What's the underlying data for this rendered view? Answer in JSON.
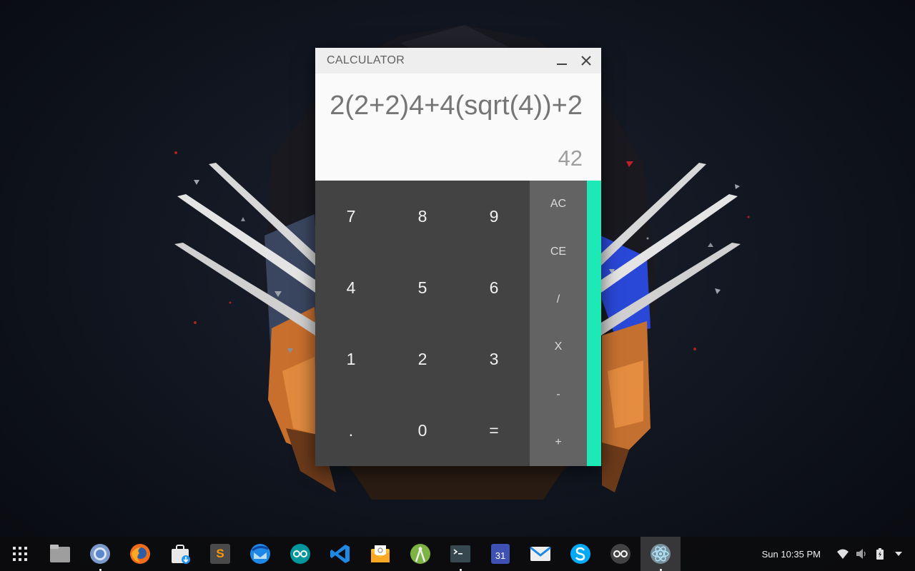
{
  "window": {
    "title": "CALCULATOR",
    "expression": "2(2+2)4+4(sqrt(4))+2",
    "result": "42"
  },
  "keypad": {
    "keys": [
      "7",
      "8",
      "9",
      "4",
      "5",
      "6",
      "1",
      "2",
      "3",
      ".",
      "0",
      "="
    ],
    "operators": [
      "AC",
      "CE",
      "/",
      "X",
      "-",
      "+"
    ]
  },
  "colors": {
    "accent": "#1de9b6",
    "keypad_bg": "#434343",
    "operator_bg": "#636363",
    "display_bg": "#fafafa"
  },
  "shelf": {
    "apps": [
      {
        "name": "files-icon",
        "active": false,
        "running": false
      },
      {
        "name": "chromium-icon",
        "active": false,
        "running": true
      },
      {
        "name": "firefox-icon",
        "active": false,
        "running": false
      },
      {
        "name": "store-download-icon",
        "active": false,
        "running": false
      },
      {
        "name": "sublime-text-icon",
        "active": false,
        "running": false
      },
      {
        "name": "thunderbird-icon",
        "active": false,
        "running": false
      },
      {
        "name": "arduino-icon",
        "active": false,
        "running": false
      },
      {
        "name": "vscode-icon",
        "active": false,
        "running": false
      },
      {
        "name": "mail-client-icon",
        "active": false,
        "running": false
      },
      {
        "name": "android-studio-icon",
        "active": false,
        "running": false
      },
      {
        "name": "terminal-icon",
        "active": false,
        "running": true
      },
      {
        "name": "calendar-icon",
        "active": false,
        "running": false
      },
      {
        "name": "gmail-icon",
        "active": false,
        "running": false
      },
      {
        "name": "skype-icon",
        "active": false,
        "running": false
      },
      {
        "name": "arduino-dark-icon",
        "active": false,
        "running": false
      },
      {
        "name": "calculator-app-icon",
        "active": true,
        "running": true
      }
    ],
    "calendar_day": "31",
    "sublime_letter": "S",
    "clock": "Sun 10:35 PM"
  }
}
